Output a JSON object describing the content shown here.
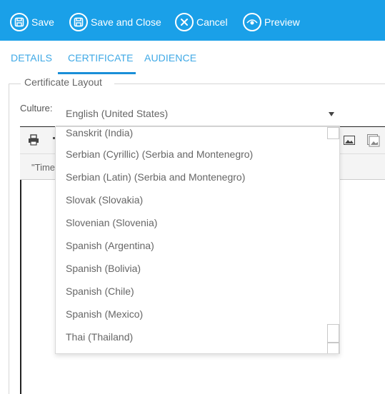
{
  "toolbar": {
    "save_label": "Save",
    "save_close_label": "Save and Close",
    "cancel_label": "Cancel",
    "preview_label": "Preview"
  },
  "tabs": [
    {
      "label": "DETAILS"
    },
    {
      "label": "CERTIFICATE"
    },
    {
      "label": "AUDIENCE"
    }
  ],
  "fieldset": {
    "legend": "Certificate Layout"
  },
  "culture": {
    "label": "Culture:",
    "selected": "English (United States)",
    "options": [
      "Sanskrit (India)",
      "Serbian (Cyrillic) (Serbia and Montenegro)",
      "Serbian (Latin) (Serbia and Montenegro)",
      "Slovak (Slovakia)",
      "Slovenian (Slovenia)",
      "Spanish (Argentina)",
      "Spanish (Bolivia)",
      "Spanish (Chile)",
      "Spanish (Mexico)",
      "Thai (Thailand)"
    ]
  },
  "editor": {
    "content_snippet": "\"Time"
  },
  "colors": {
    "toolbar_bg": "#1aa0e8",
    "tab_text": "#3fa9e6",
    "tab_underline": "#1a8fd8"
  }
}
